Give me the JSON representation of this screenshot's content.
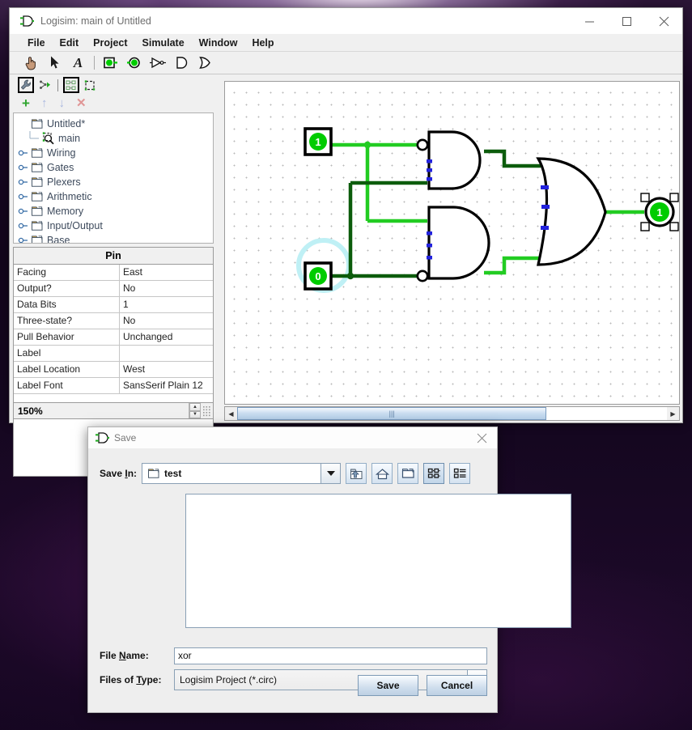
{
  "window": {
    "title": "Logisim: main of Untitled",
    "controls": {
      "minimize": "minimize-icon",
      "maximize": "maximize-icon",
      "close": "close-icon"
    }
  },
  "menubar": {
    "items": [
      "File",
      "Edit",
      "Project",
      "Simulate",
      "Window",
      "Help"
    ]
  },
  "toolbar": {
    "tools": [
      {
        "name": "poke-tool",
        "icon": "hand-icon"
      },
      {
        "name": "select-tool",
        "icon": "arrow-cursor-icon"
      },
      {
        "name": "text-tool",
        "icon": "text-A-icon"
      },
      {
        "name": "input-pin-tool",
        "icon": "input-pin-icon"
      },
      {
        "name": "output-pin-tool",
        "icon": "output-pin-icon"
      },
      {
        "name": "not-gate-tool",
        "icon": "not-gate-icon"
      },
      {
        "name": "and-gate-tool",
        "icon": "and-gate-icon"
      },
      {
        "name": "or-gate-tool",
        "icon": "or-gate-icon"
      }
    ]
  },
  "explorer": {
    "toolbar": [
      {
        "name": "edit-tool-attributes",
        "icon": "wrench-icon",
        "selected": true
      },
      {
        "name": "simulation-tree",
        "icon": "sim-tree-icon",
        "selected": false
      },
      {
        "name": "explorer-toolbar",
        "icon": "layout-icon",
        "selected": true
      },
      {
        "name": "add-circuit",
        "icon": "circuit-icon",
        "selected": false
      }
    ],
    "actions": [
      {
        "name": "add-button",
        "glyph": "+",
        "color": "#2fa52f"
      },
      {
        "name": "move-up-button",
        "glyph": "↑",
        "color": "#a9b8df"
      },
      {
        "name": "move-down-button",
        "glyph": "↓",
        "color": "#a9b8df"
      },
      {
        "name": "delete-button",
        "glyph": "✕",
        "color": "#e09696"
      }
    ],
    "tree": [
      {
        "label": "Untitled*",
        "type": "project",
        "depth": 0,
        "expander": false
      },
      {
        "label": "main",
        "type": "circuit",
        "depth": 1,
        "expander": false
      },
      {
        "label": "Wiring",
        "type": "folder",
        "depth": 0,
        "expander": true
      },
      {
        "label": "Gates",
        "type": "folder",
        "depth": 0,
        "expander": true
      },
      {
        "label": "Plexers",
        "type": "folder",
        "depth": 0,
        "expander": true
      },
      {
        "label": "Arithmetic",
        "type": "folder",
        "depth": 0,
        "expander": true
      },
      {
        "label": "Memory",
        "type": "folder",
        "depth": 0,
        "expander": true
      },
      {
        "label": "Input/Output",
        "type": "folder",
        "depth": 0,
        "expander": true
      },
      {
        "label": "Base",
        "type": "folder",
        "depth": 0,
        "expander": true
      }
    ]
  },
  "properties": {
    "title": "Pin",
    "rows": [
      {
        "key": "Facing",
        "value": "East"
      },
      {
        "key": "Output?",
        "value": "No"
      },
      {
        "key": "Data Bits",
        "value": "1"
      },
      {
        "key": "Three-state?",
        "value": "No"
      },
      {
        "key": "Pull Behavior",
        "value": "Unchanged"
      },
      {
        "key": "Label",
        "value": ""
      },
      {
        "key": "Label Location",
        "value": "West"
      },
      {
        "key": "Label Font",
        "value": "SansSerif Plain 12"
      }
    ]
  },
  "zoom": {
    "level": "150%"
  },
  "circuit": {
    "input_a": {
      "name": "input-pin-a",
      "value": "1",
      "selected": false
    },
    "input_b": {
      "name": "input-pin-b",
      "value": "0",
      "selected": false,
      "halo": true
    },
    "output": {
      "name": "output-pin",
      "value": "1",
      "selected": true
    },
    "gates": [
      {
        "name": "and-gate-top",
        "type": "and",
        "inverted_input": "top"
      },
      {
        "name": "and-gate-bottom",
        "type": "and",
        "inverted_input": "bottom"
      },
      {
        "name": "or-gate",
        "type": "or"
      }
    ],
    "colors": {
      "wire_on": "#22cc22",
      "wire_off": "#0c5c0c",
      "pin_fill": "#00cc00",
      "pin_border": "#000000",
      "input_marker": "#2222dd"
    }
  },
  "dialog": {
    "title": "Save",
    "save_in_label": "Save In:",
    "save_in_value": "test",
    "nav_buttons": [
      {
        "name": "go-up-button",
        "icon": "folder-up-icon"
      },
      {
        "name": "home-button",
        "icon": "home-icon"
      },
      {
        "name": "new-folder-button",
        "icon": "new-folder-icon"
      },
      {
        "name": "tiles-view-button",
        "icon": "tiles-view-icon",
        "selected": true
      },
      {
        "name": "details-view-button",
        "icon": "details-view-icon",
        "selected": false
      }
    ],
    "file_name_label": "File Name:",
    "file_name_label_parts": [
      "File ",
      "N",
      "ame:"
    ],
    "file_name_value": "xor",
    "files_of_type_label": "Files of Type:",
    "files_of_type_label_parts": [
      "Files of ",
      "T",
      "ype:"
    ],
    "files_of_type_value": "Logisim Project (*.circ)",
    "save_button": "Save",
    "cancel_button": "Cancel"
  }
}
